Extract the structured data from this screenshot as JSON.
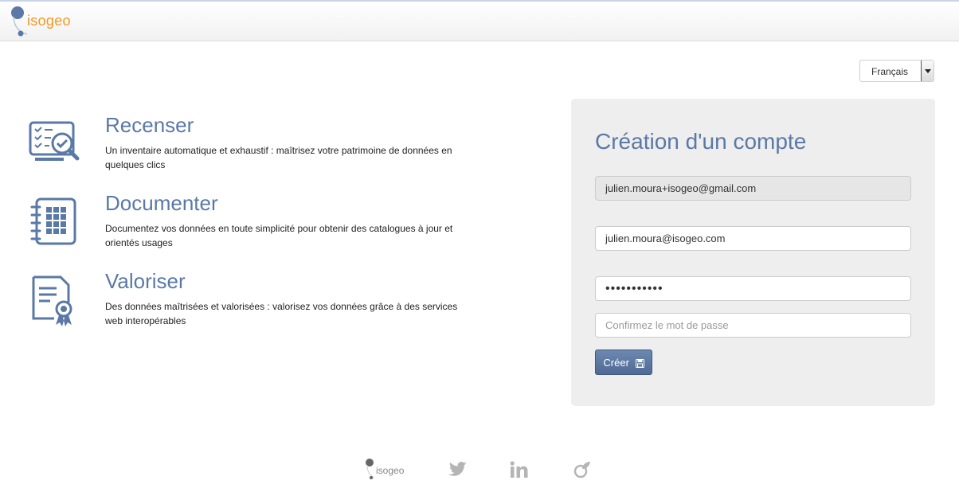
{
  "header": {
    "brand": "isogeo"
  },
  "language": {
    "selected": "Français"
  },
  "features": [
    {
      "title": "Recenser",
      "description": "Un inventaire automatique et exhaustif : maîtrisez votre patrimoine de données en quelques clics",
      "icon": "inventory-search-icon"
    },
    {
      "title": "Documenter",
      "description": "Documentez vos données en toute simplicité pour obtenir des catalogues à jour et orientés usages",
      "icon": "notebook-grid-icon"
    },
    {
      "title": "Valoriser",
      "description": "Des données maîtrisées et valorisées : valorisez vos données grâce à des services web interopérables",
      "icon": "certificate-icon"
    }
  ],
  "signup": {
    "title": "Création d'un compte",
    "email_readonly": "julien.moura+isogeo@gmail.com",
    "email": "julien.moura@isogeo.com",
    "password": "•••••••••••",
    "confirm_placeholder": "Confirmez le mot de passe",
    "submit_label": "Créer",
    "submit_icon": "floppy-disk-icon"
  },
  "footer": {
    "brand": "isogeo",
    "social_icons": [
      "twitter-icon",
      "linkedin-icon",
      "isogeo-leaf-icon"
    ]
  },
  "colors": {
    "accent_blue": "#5a79a6",
    "brand_orange": "#f29a1f",
    "panel_bg": "#eeeeee",
    "button_blue": "#5a769f"
  }
}
